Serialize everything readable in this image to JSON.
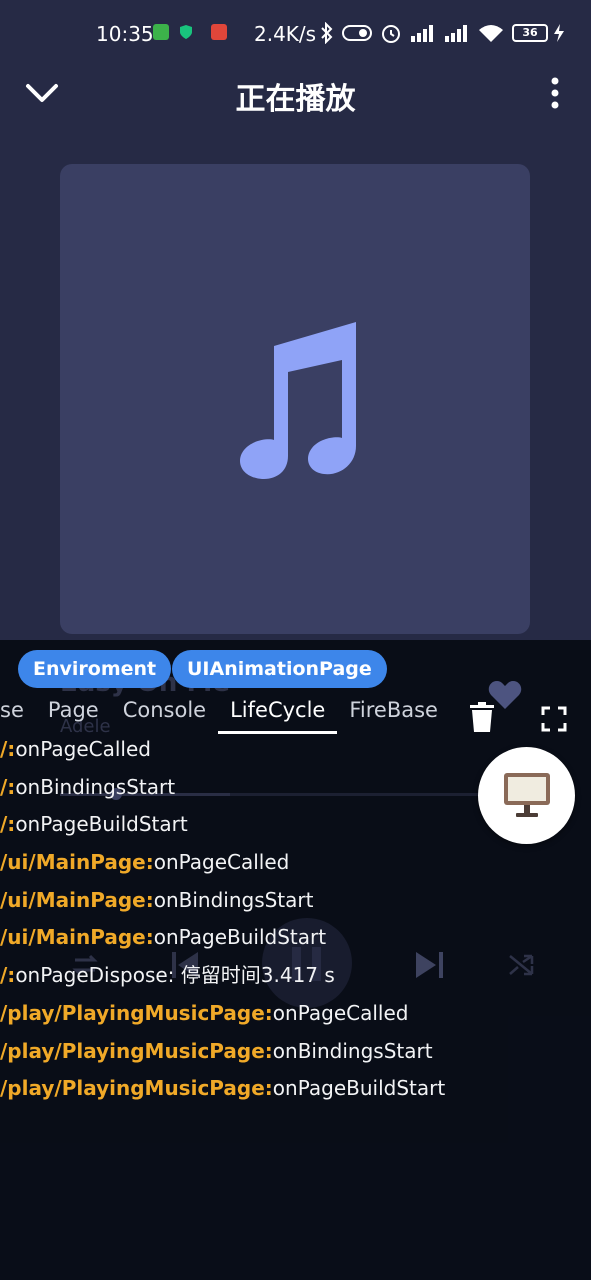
{
  "status_bar": {
    "time": "10:35",
    "net_speed": "2.4K/s",
    "battery": "36"
  },
  "header": {
    "title": "正在播放"
  },
  "player": {
    "song_title": "Easy On Me",
    "artist": "Adele",
    "progress": 0.12
  },
  "debug": {
    "chips": [
      "Enviroment",
      "UIAnimationPage"
    ],
    "tabs": [
      "se",
      "Page",
      "Console",
      "LifeCycle",
      "FireBase"
    ],
    "active_tab": "LifeCycle",
    "logs": [
      {
        "route": "/:",
        "msg": "onPageCalled"
      },
      {
        "route": "/:",
        "msg": "onBindingsStart"
      },
      {
        "route": "/:",
        "msg": "onPageBuildStart"
      },
      {
        "route": "/ui/MainPage:",
        "msg": "onPageCalled"
      },
      {
        "route": "/ui/MainPage:",
        "msg": "onBindingsStart"
      },
      {
        "route": "/ui/MainPage:",
        "msg": "onPageBuildStart"
      },
      {
        "route": "/:",
        "msg": "onPageDispose: 停留时间3.417 s"
      },
      {
        "route": "/play/PlayingMusicPage:",
        "msg": "onPageCalled"
      },
      {
        "route": "/play/PlayingMusicPage:",
        "msg": "onBindingsStart"
      },
      {
        "route": "/play/PlayingMusicPage:",
        "msg": "onPageBuildStart"
      }
    ]
  },
  "colors": {
    "background": "#262a45",
    "album_card": "#3a3f63",
    "note": "#8fa3f7",
    "chip": "#3d86ea",
    "log_route": "#f0a928"
  }
}
